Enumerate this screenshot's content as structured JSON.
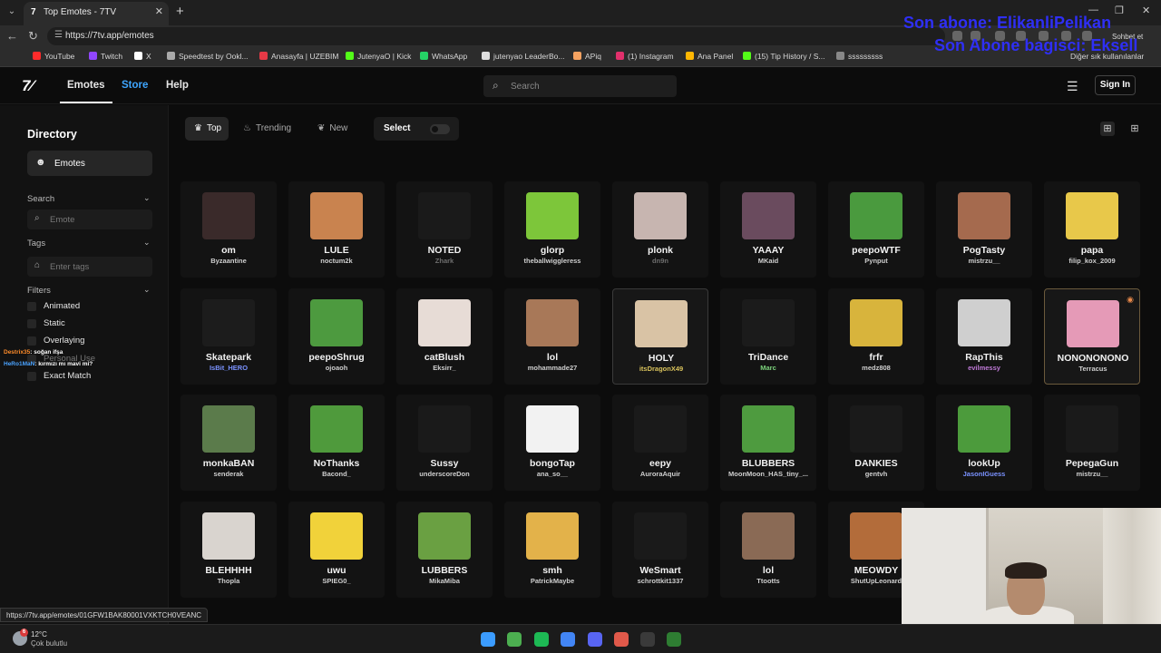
{
  "browser": {
    "tab_title": "Top Emotes - 7TV",
    "tab_favicon": "7",
    "url": "https://7tv.app/emotes",
    "status_url": "https://7tv.app/emotes/01GFW1BAK80001VXKTCH0VEANC",
    "bookmarks": [
      {
        "label": "YouTube",
        "color": "#ff2b2b"
      },
      {
        "label": "Twitch",
        "color": "#9146ff"
      },
      {
        "label": "X",
        "color": "#ffffff"
      },
      {
        "label": "Speedtest by Ookl...",
        "color": "#aaaaaa"
      },
      {
        "label": "Anasayfa | UZEBIM",
        "color": "#e63946"
      },
      {
        "label": "JutenyaO | Kick",
        "color": "#53fc18"
      },
      {
        "label": "WhatsApp",
        "color": "#25d366"
      },
      {
        "label": "jutenyao LeaderBo...",
        "color": "#dddddd"
      },
      {
        "label": "APiq",
        "color": "#f4a261"
      },
      {
        "label": "(1) Instagram",
        "color": "#e1306c"
      },
      {
        "label": "Ana Panel",
        "color": "#ffb703"
      },
      {
        "label": "(15) Tip History / S...",
        "color": "#53fc18"
      },
      {
        "label": "sssssssss",
        "color": "#888888"
      }
    ],
    "other_bookmarks": "Diğer sık kullanılanlar",
    "chat_label": "Sohbet et"
  },
  "overlay": {
    "line1": "Son abone: ElikanliPelikan",
    "line2": "Son Abone bagisci: Eksell"
  },
  "header": {
    "logo": "7TV",
    "nav": [
      {
        "label": "Emotes",
        "color": "#ffffff"
      },
      {
        "label": "Store",
        "color": "#3ea6ff"
      },
      {
        "label": "Help",
        "color": "#ffffff"
      }
    ],
    "search_placeholder": "Search",
    "sign_in": "Sign In"
  },
  "sidebar": {
    "title": "Directory",
    "emotes_item": "Emotes",
    "search_label": "Search",
    "search_placeholder": "Emote",
    "tags_label": "Tags",
    "tags_placeholder": "Enter tags",
    "filters_label": "Filters",
    "filters": [
      "Animated",
      "Static",
      "Overlaying",
      "Personal Use",
      "Exact Match"
    ],
    "chat": [
      {
        "user": "Destrix35",
        "msg": ": soğan ifşa",
        "color": "#ff8c2a"
      },
      {
        "user": "HeRo1MaN",
        "msg": ": kırmızı mı mavi mi?",
        "color": "#4aa3ff"
      }
    ]
  },
  "toolbar": {
    "tabs": [
      {
        "label": "Top",
        "icon": "trophy-icon"
      },
      {
        "label": "Trending",
        "icon": "fire-icon"
      },
      {
        "label": "New",
        "icon": "sprout-icon"
      }
    ],
    "select_label": "Select"
  },
  "emotes": [
    {
      "name": "om",
      "owner": "Byzaantine",
      "owner_style": "plain",
      "thumb": "#3a2a2a"
    },
    {
      "name": "LULE",
      "owner": "noctum2k",
      "owner_style": "plain",
      "thumb": "#c9834f"
    },
    {
      "name": "NOTED",
      "owner": "Zhark",
      "owner_style": "dim",
      "thumb": "#1a1a1a"
    },
    {
      "name": "glorp",
      "owner": "theballwiggleress",
      "owner_style": "plain",
      "thumb": "#7dc63a"
    },
    {
      "name": "plonk",
      "owner": "dn9n",
      "owner_style": "dim",
      "thumb": "#c7b5b0"
    },
    {
      "name": "YAAAY",
      "owner": "MKaid",
      "owner_style": "plain",
      "thumb": "#6a4b5e"
    },
    {
      "name": "peepoWTF",
      "owner": "Pynput",
      "owner_style": "plain",
      "thumb": "#4a9a3e"
    },
    {
      "name": "PogTasty",
      "owner": "mistrzu__",
      "owner_style": "plain",
      "thumb": "#a56a4e"
    },
    {
      "name": "papa",
      "owner": "filip_kox_2009",
      "owner_style": "plain",
      "thumb": "#e8c84a"
    },
    {
      "name": "Skatepark",
      "owner": "IsBit_HERO",
      "owner_style": "blue",
      "thumb": "#1c1c1c"
    },
    {
      "name": "peepoShrug",
      "owner": "ojoaoh",
      "owner_style": "plain",
      "thumb": "#4d9a3f"
    },
    {
      "name": "catBlush",
      "owner": "Eksirr_",
      "owner_style": "plain",
      "thumb": "#e7dcd6"
    },
    {
      "name": "lol",
      "owner": "mohammade27",
      "owner_style": "plain",
      "thumb": "#a87858"
    },
    {
      "name": "HOLY",
      "owner": "itsDragonX49",
      "owner_style": "yellow",
      "thumb": "#d9c3a5"
    },
    {
      "name": "TriDance",
      "owner": "Marc",
      "owner_style": "green",
      "thumb": "#1b1b1b"
    },
    {
      "name": "frfr",
      "owner": "medz808",
      "owner_style": "plain",
      "thumb": "#d8b43c"
    },
    {
      "name": "RapThis",
      "owner": "evilmessy",
      "owner_style": "purple",
      "thumb": "#cfcfcf"
    },
    {
      "name": "NONONONONO",
      "owner": "Terracus",
      "owner_style": "plain",
      "thumb": "#e59ab7"
    },
    {
      "name": "monkaBAN",
      "owner": "senderak",
      "owner_style": "plain",
      "thumb": "#5b7b4b"
    },
    {
      "name": "NoThanks",
      "owner": "Bacond_",
      "owner_style": "plain",
      "thumb": "#4f9a3c"
    },
    {
      "name": "Sussy",
      "owner": "underscoreDon",
      "owner_style": "plain",
      "thumb": "#1a1a1a"
    },
    {
      "name": "bongoTap",
      "owner": "ana_so__",
      "owner_style": "plain",
      "thumb": "#f2f2f2"
    },
    {
      "name": "eepy",
      "owner": "AuroraAquir",
      "owner_style": "plain",
      "thumb": "#1a1a1a"
    },
    {
      "name": "BLUBBERS",
      "owner": "MoonMoon_HAS_tiny_...",
      "owner_style": "plain",
      "thumb": "#4e9b3f"
    },
    {
      "name": "DANKIES",
      "owner": "gentvh",
      "owner_style": "plain",
      "thumb": "#1a1a1a"
    },
    {
      "name": "lookUp",
      "owner": "JasonIGuess",
      "owner_style": "blue",
      "thumb": "#4c9b3c"
    },
    {
      "name": "PepegaGun",
      "owner": "mistrzu__",
      "owner_style": "plain",
      "thumb": "#1a1a1a"
    },
    {
      "name": "BLEHHHH",
      "owner": "Thopla",
      "owner_style": "plain",
      "thumb": "#d9d4cf"
    },
    {
      "name": "uwu",
      "owner": "SPIEG0_",
      "owner_style": "plain",
      "thumb": "#f1d23a"
    },
    {
      "name": "LUBBERS",
      "owner": "MikaMiba",
      "owner_style": "plain",
      "thumb": "#6aa042"
    },
    {
      "name": "smh",
      "owner": "PatrickMaybe",
      "owner_style": "plain",
      "thumb": "#e3b24a"
    },
    {
      "name": "WeSmart",
      "owner": "schrottkit1337",
      "owner_style": "plain",
      "thumb": "#1a1a1a"
    },
    {
      "name": "lol",
      "owner": "Ttootts",
      "owner_style": "plain",
      "thumb": "#8a6a55"
    },
    {
      "name": "MEOWDY",
      "owner": "ShutUpLeonard",
      "owner_style": "plain",
      "thumb": "#b36c3a"
    }
  ],
  "taskbar": {
    "temperature": "12°C",
    "weather": "Çok bulutlu",
    "badge": "6",
    "apps": [
      {
        "icon": "windows-start-icon",
        "color": "#3b9cff"
      },
      {
        "icon": "chrome-icon",
        "color": "#4caf50"
      },
      {
        "icon": "spotify-icon",
        "color": "#1db954"
      },
      {
        "icon": "chrome-profile-icon",
        "color": "#4285f4"
      },
      {
        "icon": "discord-icon",
        "color": "#5865f2"
      },
      {
        "icon": "app-icon",
        "color": "#e0594a"
      },
      {
        "icon": "obs-icon",
        "color": "#3a3a3a"
      },
      {
        "icon": "app-icon-2",
        "color": "#2e7d32"
      }
    ]
  }
}
